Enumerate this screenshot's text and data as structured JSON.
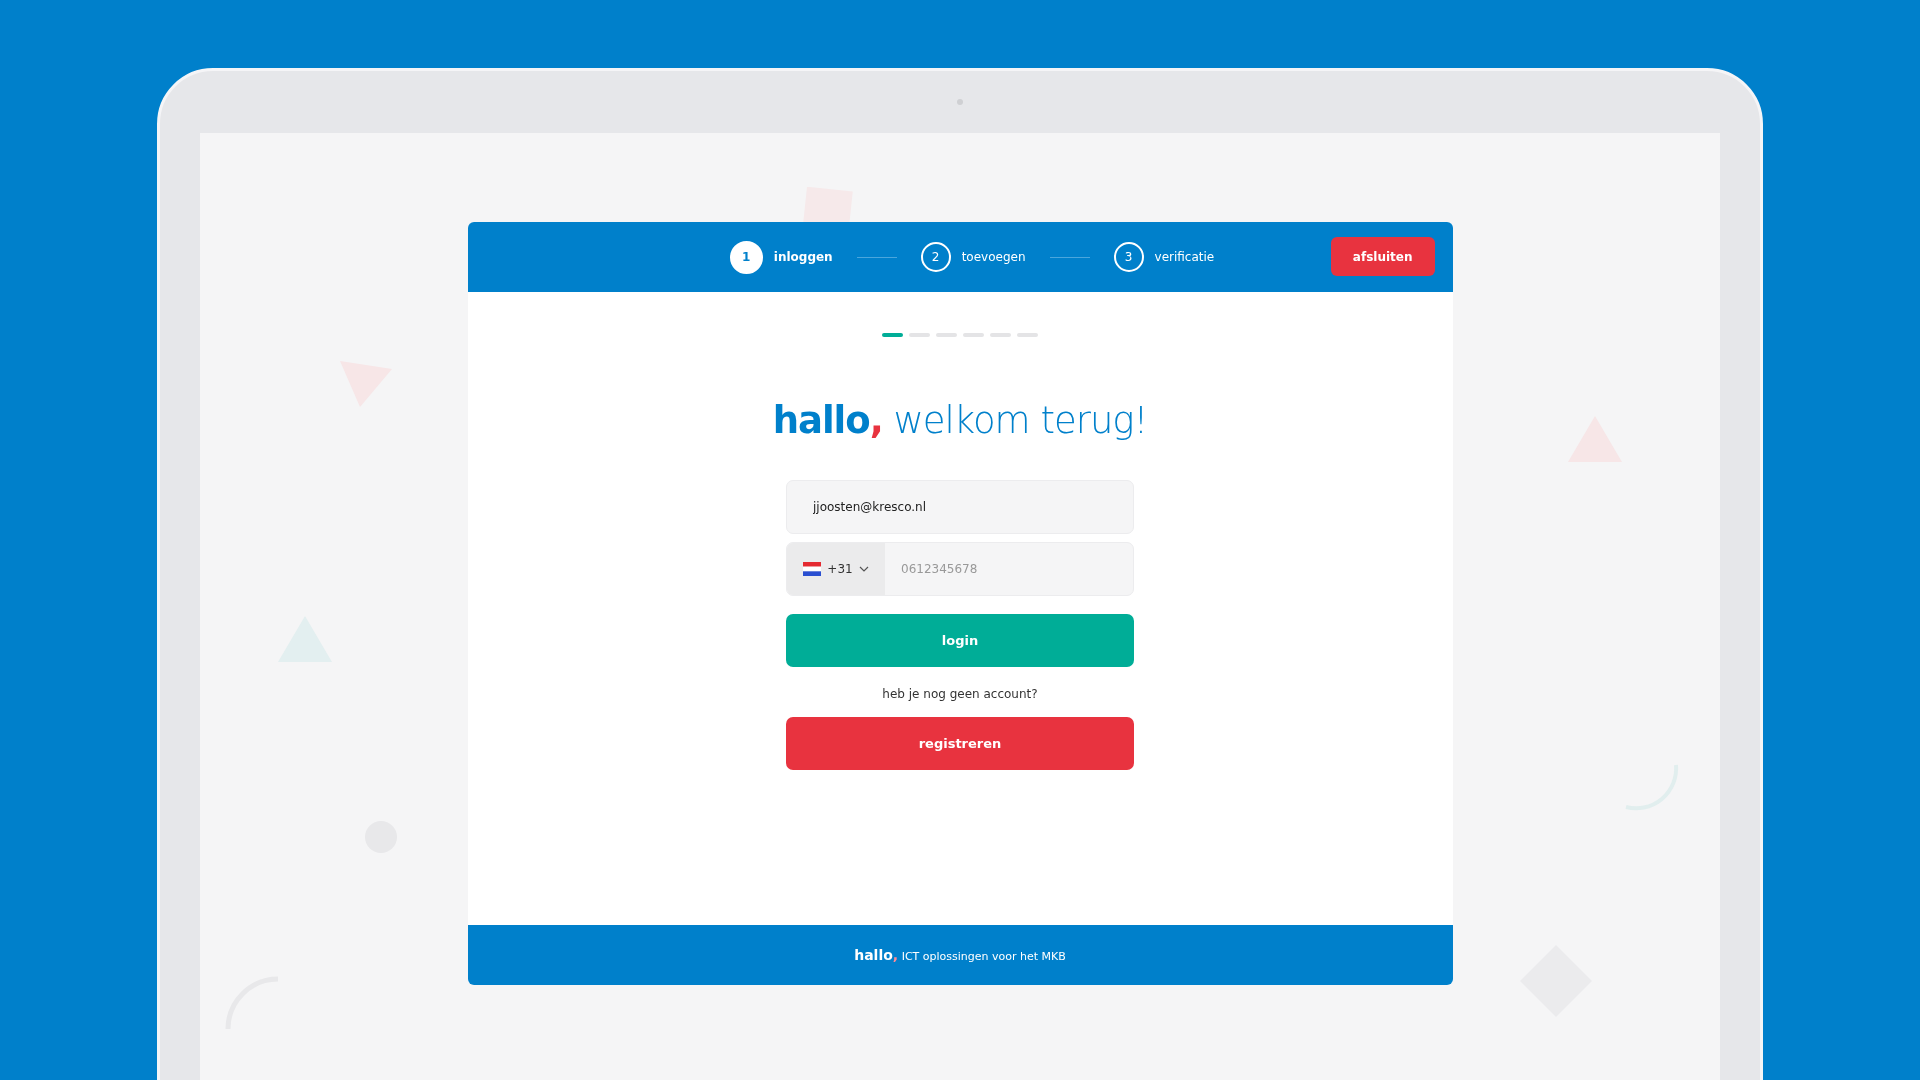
{
  "steps": [
    {
      "number": "1",
      "label": "inloggen",
      "selected": true
    },
    {
      "number": "2",
      "label": "toevoegen",
      "selected": false
    },
    {
      "number": "3",
      "label": "verificatie",
      "selected": false
    }
  ],
  "close_button": "afsluiten",
  "progress_dots": [
    {
      "selected": true
    },
    {
      "selected": false
    },
    {
      "selected": false
    },
    {
      "selected": false
    },
    {
      "selected": false
    },
    {
      "selected": false
    }
  ],
  "heading": {
    "brand": "hallo",
    "comma": ",",
    "rest": "welkom terug!"
  },
  "email_field": {
    "value": "jjoosten@kresco.nl"
  },
  "phone": {
    "country_code": "+31",
    "placeholder": "0612345678"
  },
  "login_button": "login",
  "no_account_text": "heb je nog geen account?",
  "register_button": "registreren",
  "footer": {
    "brand": "hallo",
    "comma": ",",
    "text": "ICT oplossingen voor het MKB"
  }
}
